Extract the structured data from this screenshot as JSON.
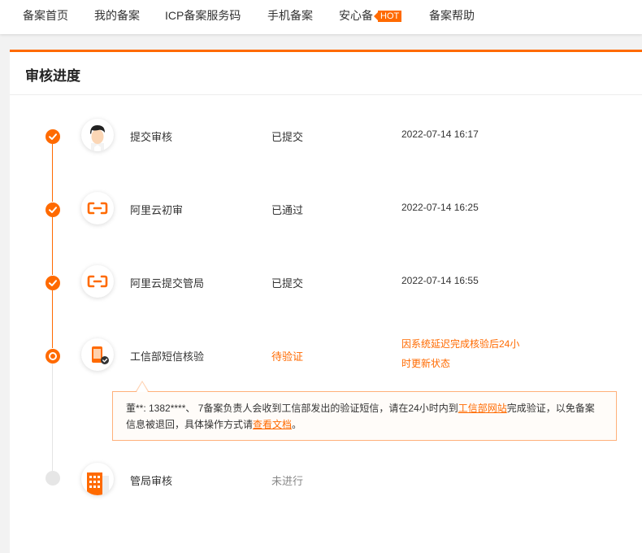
{
  "nav": {
    "items": [
      "备案首页",
      "我的备案",
      "ICP备案服务码",
      "手机备案",
      "安心备"
    ],
    "hot": "HOT",
    "help": "备案帮助"
  },
  "card": {
    "title": "审核进度"
  },
  "steps": [
    {
      "name": "提交审核",
      "status": "已提交",
      "time": "2022-07-14 16:17",
      "icon": "user-avatar-icon",
      "state": "done"
    },
    {
      "name": "阿里云初审",
      "status": "已通过",
      "time": "2022-07-14 16:25",
      "icon": "aliyun-logo-icon",
      "state": "done"
    },
    {
      "name": "阿里云提交管局",
      "status": "已提交",
      "time": "2022-07-14 16:55",
      "icon": "aliyun-logo-icon",
      "state": "done"
    },
    {
      "name": "工信部短信核验",
      "status": "待验证",
      "note_line1": "因系统延迟完成核验后24小",
      "note_line2": "时更新状态",
      "icon": "phone-verify-icon",
      "state": "current"
    },
    {
      "name": "管局审核",
      "status": "未进行",
      "icon": "building-icon",
      "state": "pending"
    }
  ],
  "tip": {
    "part1": "董**: 1382****、 7备案负责人会收到工信部发出的验证短信，请在24小时内到",
    "link1": "工信部网站",
    "part2": "完成验证，以免备案信息被退回，具体操作方式请",
    "link2": "查看文档",
    "part3": "。"
  },
  "colors": {
    "accent": "#ff6a00",
    "pending": "#e6e6e6"
  }
}
